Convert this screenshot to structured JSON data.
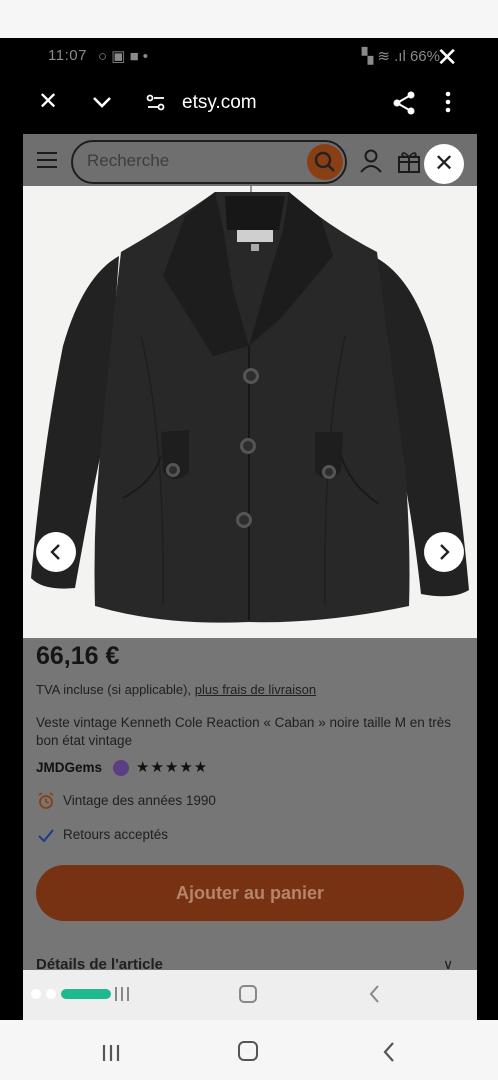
{
  "status_bar": {
    "time": "11:07",
    "left_icons": "○ ▣ ■ •",
    "right_text": "66%"
  },
  "browser": {
    "url": "etsy.com"
  },
  "header": {
    "search_placeholder": "Recherche"
  },
  "product": {
    "price": "66,16 €",
    "tva_prefix": "TVA incluse (si applicable),",
    "tva_link": "plus frais de livraison",
    "title": "Veste vintage Kenneth Cole Reaction « Caban » noire taille M en très bon état vintage",
    "shop_name": "JMDGems",
    "rating_stars": "★★★★★",
    "rating_value": 5,
    "feature_vintage": "Vintage des années 1990",
    "feature_returns": "Retours acceptés",
    "add_to_cart": "Ajouter au panier",
    "details_label": "Détails de l'article",
    "details_chevron": "∨"
  },
  "colors": {
    "accent_orange": "#8a3e14",
    "cart_button": "#773214",
    "dim_overlay": "#767676",
    "toggle_green": "#1eb98f"
  },
  "icons": [
    "close-icon",
    "chevron-down-icon",
    "site-settings-icon",
    "share-icon",
    "more-vertical-icon",
    "menu-icon",
    "search-icon",
    "user-icon",
    "gift-icon",
    "chevron-left-icon",
    "chevron-right-icon",
    "alarm-clock-icon",
    "checkmark-icon",
    "recents-icon",
    "home-icon",
    "back-icon"
  ]
}
